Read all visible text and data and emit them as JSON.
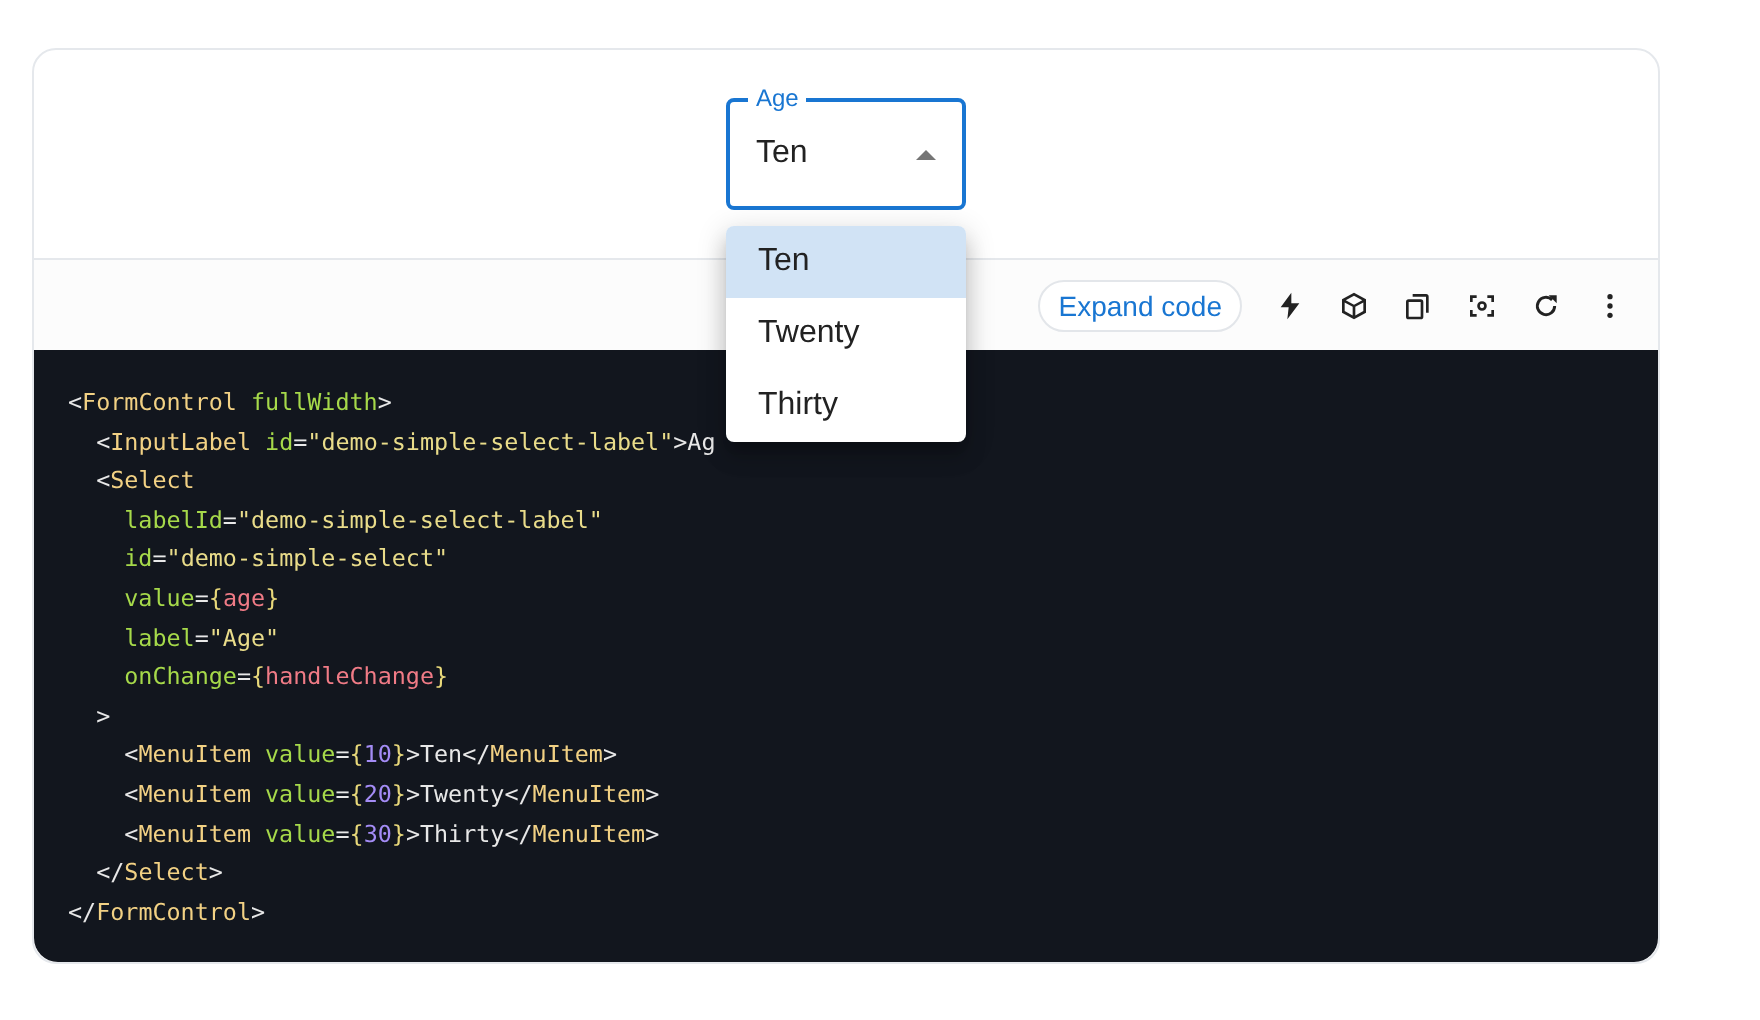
{
  "select": {
    "label": "Age",
    "value": "Ten",
    "expanded": true,
    "options": [
      {
        "label": "Ten",
        "selected": true
      },
      {
        "label": "Twenty",
        "selected": false
      },
      {
        "label": "Thirty",
        "selected": false
      }
    ]
  },
  "toolbar": {
    "expand_button": "Expand code"
  },
  "code": [
    [
      {
        "kind": "punct",
        "text": "<"
      },
      {
        "kind": "tag",
        "text": "FormControl"
      },
      {
        "kind": "attr",
        "text": " fullWidth"
      },
      {
        "kind": "punct",
        "text": ">"
      }
    ],
    [
      {
        "kind": "punct",
        "text": "  <"
      },
      {
        "kind": "tag",
        "text": "InputLabel"
      },
      {
        "kind": "attr",
        "text": " id"
      },
      {
        "kind": "punct",
        "text": "="
      },
      {
        "kind": "string",
        "text": "\"demo-simple-select-label\""
      },
      {
        "kind": "punct",
        "text": ">Ag"
      }
    ],
    [
      {
        "kind": "punct",
        "text": "  <"
      },
      {
        "kind": "tag",
        "text": "Select"
      }
    ],
    [
      {
        "kind": "attr",
        "text": "    labelId"
      },
      {
        "kind": "punct",
        "text": "="
      },
      {
        "kind": "string",
        "text": "\"demo-simple-select-label\""
      }
    ],
    [
      {
        "kind": "attr",
        "text": "    id"
      },
      {
        "kind": "punct",
        "text": "="
      },
      {
        "kind": "string",
        "text": "\"demo-simple-select\""
      }
    ],
    [
      {
        "kind": "attr",
        "text": "    value"
      },
      {
        "kind": "punct",
        "text": "="
      },
      {
        "kind": "brace",
        "text": "{"
      },
      {
        "kind": "expr",
        "text": "age"
      },
      {
        "kind": "brace",
        "text": "}"
      }
    ],
    [
      {
        "kind": "attr",
        "text": "    label"
      },
      {
        "kind": "punct",
        "text": "="
      },
      {
        "kind": "string",
        "text": "\"Age\""
      }
    ],
    [
      {
        "kind": "attr",
        "text": "    onChange"
      },
      {
        "kind": "punct",
        "text": "="
      },
      {
        "kind": "brace",
        "text": "{"
      },
      {
        "kind": "expr",
        "text": "handleChange"
      },
      {
        "kind": "brace",
        "text": "}"
      }
    ],
    [
      {
        "kind": "punct",
        "text": "  >"
      }
    ],
    [
      {
        "kind": "punct",
        "text": "    <"
      },
      {
        "kind": "tag",
        "text": "MenuItem"
      },
      {
        "kind": "attr",
        "text": " value"
      },
      {
        "kind": "punct",
        "text": "="
      },
      {
        "kind": "brace",
        "text": "{"
      },
      {
        "kind": "number",
        "text": "10"
      },
      {
        "kind": "brace",
        "text": "}"
      },
      {
        "kind": "punct",
        "text": ">Ten</"
      },
      {
        "kind": "tag",
        "text": "MenuItem"
      },
      {
        "kind": "punct",
        "text": ">"
      }
    ],
    [
      {
        "kind": "punct",
        "text": "    <"
      },
      {
        "kind": "tag",
        "text": "MenuItem"
      },
      {
        "kind": "attr",
        "text": " value"
      },
      {
        "kind": "punct",
        "text": "="
      },
      {
        "kind": "brace",
        "text": "{"
      },
      {
        "kind": "number",
        "text": "20"
      },
      {
        "kind": "brace",
        "text": "}"
      },
      {
        "kind": "punct",
        "text": ">Twenty</"
      },
      {
        "kind": "tag",
        "text": "MenuItem"
      },
      {
        "kind": "punct",
        "text": ">"
      }
    ],
    [
      {
        "kind": "punct",
        "text": "    <"
      },
      {
        "kind": "tag",
        "text": "MenuItem"
      },
      {
        "kind": "attr",
        "text": " value"
      },
      {
        "kind": "punct",
        "text": "="
      },
      {
        "kind": "brace",
        "text": "{"
      },
      {
        "kind": "number",
        "text": "30"
      },
      {
        "kind": "brace",
        "text": "}"
      },
      {
        "kind": "punct",
        "text": ">Thirty</"
      },
      {
        "kind": "tag",
        "text": "MenuItem"
      },
      {
        "kind": "punct",
        "text": ">"
      }
    ],
    [
      {
        "kind": "punct",
        "text": "  </"
      },
      {
        "kind": "tag",
        "text": "Select"
      },
      {
        "kind": "punct",
        "text": ">"
      }
    ],
    [
      {
        "kind": "punct",
        "text": "</"
      },
      {
        "kind": "tag",
        "text": "FormControl"
      },
      {
        "kind": "punct",
        "text": ">"
      }
    ]
  ]
}
